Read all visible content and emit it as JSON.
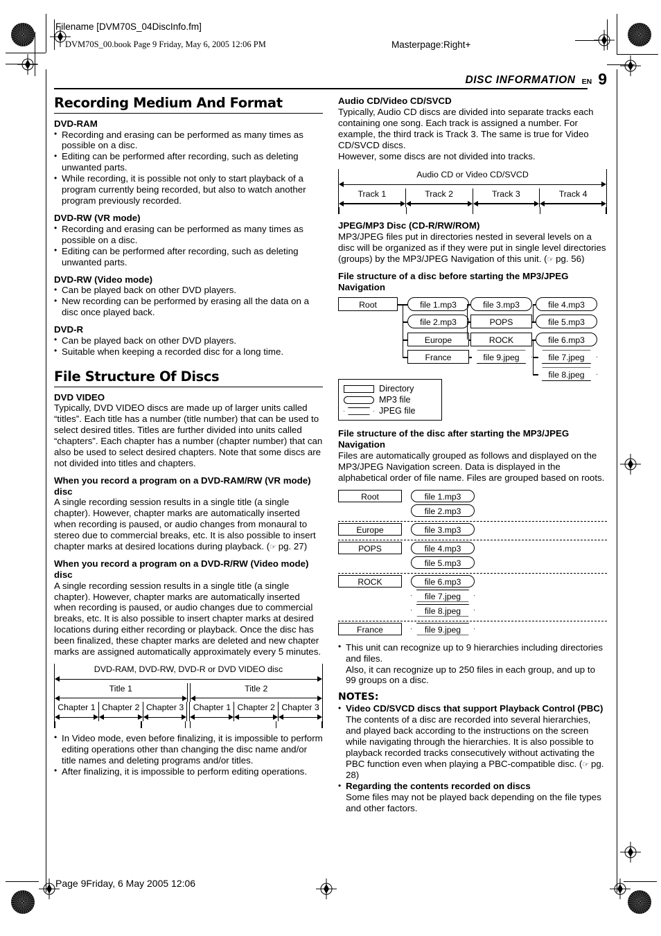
{
  "imposition": {
    "filename": "Filename [DVM70S_04DiscInfo.fm]",
    "book_line": "DVM70S_00.book  Page 9  Friday, May 6, 2005  12:06 PM",
    "masterpage": "Masterpage:Right+",
    "footer": "Page 9Friday, 6 May 2005  12:06"
  },
  "running_head": {
    "title": "DISC INFORMATION",
    "lang": "EN",
    "page_number": "9"
  },
  "left_column": {
    "section1_title": "Recording Medium And Format",
    "dvd_ram": {
      "heading": "DVD-RAM",
      "bullets": [
        "Recording and erasing can be performed as many times as possible on a disc.",
        "Editing can be performed after recording, such as deleting unwanted parts.",
        "While recording, it is possible not only to start playback of a program currently being recorded, but also to watch another program previously recorded."
      ]
    },
    "dvd_rw_vr": {
      "heading": "DVD-RW (VR mode)",
      "bullets": [
        "Recording and erasing can be performed as many times as possible on a disc.",
        "Editing can be performed after recording, such as deleting unwanted parts."
      ]
    },
    "dvd_rw_video": {
      "heading": "DVD-RW (Video mode)",
      "bullets": [
        "Can be played back on other DVD players.",
        "New recording can be performed by erasing all the data on a disc once played back."
      ]
    },
    "dvd_r": {
      "heading": "DVD-R",
      "bullets": [
        "Can be played back on other DVD players.",
        "Suitable when keeping a recorded disc for a long time."
      ]
    },
    "section2_title": "File Structure Of Discs",
    "dvd_video": {
      "heading": "DVD VIDEO",
      "body": "Typically, DVD VIDEO discs are made up of larger units called “titles”. Each title has a number (title number) that can be used to select desired titles. Titles are further divided into units called “chapters”. Each chapter has a number (chapter number) that can also be used to select desired chapters. Note that some discs are not divided into titles and chapters."
    },
    "record_vr": {
      "heading": "When you record a program on a DVD-RAM/RW (VR mode) disc",
      "body_before_ref": "A single recording session results in a single title (a single chapter). However, chapter marks are automatically inserted when recording is paused, or audio changes from monaural to stereo due to commercial breaks, etc. It is also possible to insert chapter marks at desired locations during playback. (",
      "ref_icon": "☞",
      "ref_text": " pg. 27)"
    },
    "record_video": {
      "heading": "When you record a program on a DVD-R/RW (Video mode) disc",
      "body": "A single recording session results in a single title (a single chapter). However, chapter marks are automatically inserted when recording is paused, or audio changes due to commercial breaks, etc. It is also possible to insert chapter marks at desired locations during either recording or playback. Once the disc has been finalized, these chapter marks are deleted and new chapter marks are assigned automatically approximately every 5 minutes."
    },
    "title_chapter_diagram": {
      "disc_label": "DVD-RAM, DVD-RW, DVD-R or DVD VIDEO disc",
      "titles": [
        {
          "label": "Title 1",
          "chapters": [
            "Chapter 1",
            "Chapter 2",
            "Chapter 3"
          ]
        },
        {
          "label": "Title 2",
          "chapters": [
            "Chapter 1",
            "Chapter 2",
            "Chapter 3"
          ]
        }
      ]
    },
    "closing_bullets": [
      "In Video mode, even before finalizing, it is impossible to perform editing operations other than changing the disc name and/or title names and deleting programs and/or titles.",
      "After finalizing, it is impossible to perform editing operations."
    ]
  },
  "right_column": {
    "audio_cd": {
      "heading": "Audio CD/Video CD/SVCD",
      "body": "Typically, Audio CD discs are divided into separate tracks each containing one song. Each track is assigned a number. For example, the third track is Track 3. The same is true for Video CD/SVCD discs.",
      "body2": "However, some discs are not divided into tracks.",
      "diagram": {
        "disc_label": "Audio CD or Video CD/SVCD",
        "tracks": [
          "Track 1",
          "Track 2",
          "Track 3",
          "Track 4"
        ]
      }
    },
    "jpeg_mp3": {
      "heading": "JPEG/MP3 Disc (CD-R/RW/ROM)",
      "body_before_ref": "MP3/JPEG files put in directories nested in several levels on a disc will be organized as if they were put in single level directories (groups) by the MP3/JPEG Navigation of this unit. (",
      "ref_icon": "☞",
      "ref_text": " pg. 56)",
      "before_heading": "File structure of a disc before starting the MP3/JPEG Navigation",
      "tree_nodes": {
        "root": "Root",
        "file1": "file 1.mp3",
        "file2": "file 2.mp3",
        "europe": "Europe",
        "france": "France",
        "file3": "file 3.mp3",
        "pops": "POPS",
        "rock": "ROCK",
        "file9": "file 9.jpeg",
        "file4": "file 4.mp3",
        "file5": "file 5.mp3",
        "file6": "file 6.mp3",
        "file7": "file 7.jpeg",
        "file8": "file 8.jpeg"
      },
      "legend": [
        {
          "shape": "directory",
          "label": "Directory"
        },
        {
          "shape": "mp3",
          "label": "MP3 file"
        },
        {
          "shape": "jpeg",
          "label": "JPEG file"
        }
      ],
      "after_heading": "File structure of the disc after starting the MP3/JPEG Navigation",
      "after_body": "Files are automatically grouped as follows and displayed on the MP3/JPEG Navigation screen. Data is displayed in the alphabetical order of file name. Files are grouped based on roots.",
      "groups": [
        {
          "dir": "Root",
          "files": [
            {
              "name": "file 1.mp3",
              "type": "mp3"
            },
            {
              "name": "file 2.mp3",
              "type": "mp3"
            }
          ]
        },
        {
          "dir": "Europe",
          "files": [
            {
              "name": "file 3.mp3",
              "type": "mp3"
            }
          ]
        },
        {
          "dir": "POPS",
          "files": [
            {
              "name": "file 4.mp3",
              "type": "mp3"
            },
            {
              "name": "file 5.mp3",
              "type": "mp3"
            }
          ]
        },
        {
          "dir": "ROCK",
          "files": [
            {
              "name": "file 6.mp3",
              "type": "mp3"
            },
            {
              "name": "file 7.jpeg",
              "type": "jpeg"
            },
            {
              "name": "file 8.jpeg",
              "type": "jpeg"
            }
          ]
        },
        {
          "dir": "France",
          "files": [
            {
              "name": "file 9.jpeg",
              "type": "jpeg"
            }
          ]
        }
      ],
      "capacity_bullet": "This unit can recognize up to 9 hierarchies including directories and files.",
      "capacity_line2": "Also, it can recognize up to 250 files in each group, and up to 99 groups on a disc."
    },
    "notes": {
      "heading": "NOTES:",
      "items": [
        {
          "bold": "Video CD/SVCD discs that support Playback Control (PBC)",
          "body_before_ref": "The contents of a disc are recorded into several hierarchies, and played back according to the instructions on the screen while navigating through the hierarchies. It is also possible to playback recorded tracks consecutively without activating the PBC function even when playing a PBC-compatible disc. (",
          "ref_icon": "☞",
          "ref_text": " pg. 28)"
        },
        {
          "bold": "Regarding the contents recorded on discs",
          "body_before_ref": "Some files may not be played back depending on the file types and other factors.",
          "ref_icon": "",
          "ref_text": ""
        }
      ]
    }
  }
}
